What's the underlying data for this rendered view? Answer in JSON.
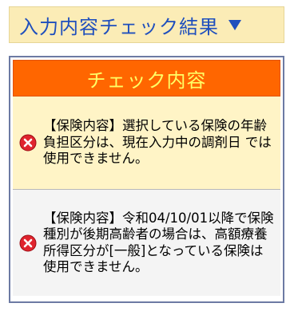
{
  "header": {
    "title": "入力内容チェック結果",
    "arrow_icon": "triangle-down-icon"
  },
  "panel": {
    "title": "チェック内容",
    "messages": [
      {
        "icon": "error-icon",
        "text": "【保険内容】選択している保険の年齢負担区分は、現在入力中の調剤日 では使用できません。"
      },
      {
        "icon": "error-icon",
        "text": "【保険内容】令和04/10/01以降で保険種別が後期高齢者の場合は、高額療養所得区分が[一般]となっている保険は使用できません。"
      }
    ]
  },
  "colors": {
    "header_bg": "#fbecb6",
    "header_text": "#1f4fbd",
    "panel_title_bg": "#ff6600",
    "panel_title_text": "#ffff66",
    "message_1_bg": "#fff4c6",
    "message_2_bg": "#f4f4f4",
    "error_icon": "#e0242e"
  }
}
